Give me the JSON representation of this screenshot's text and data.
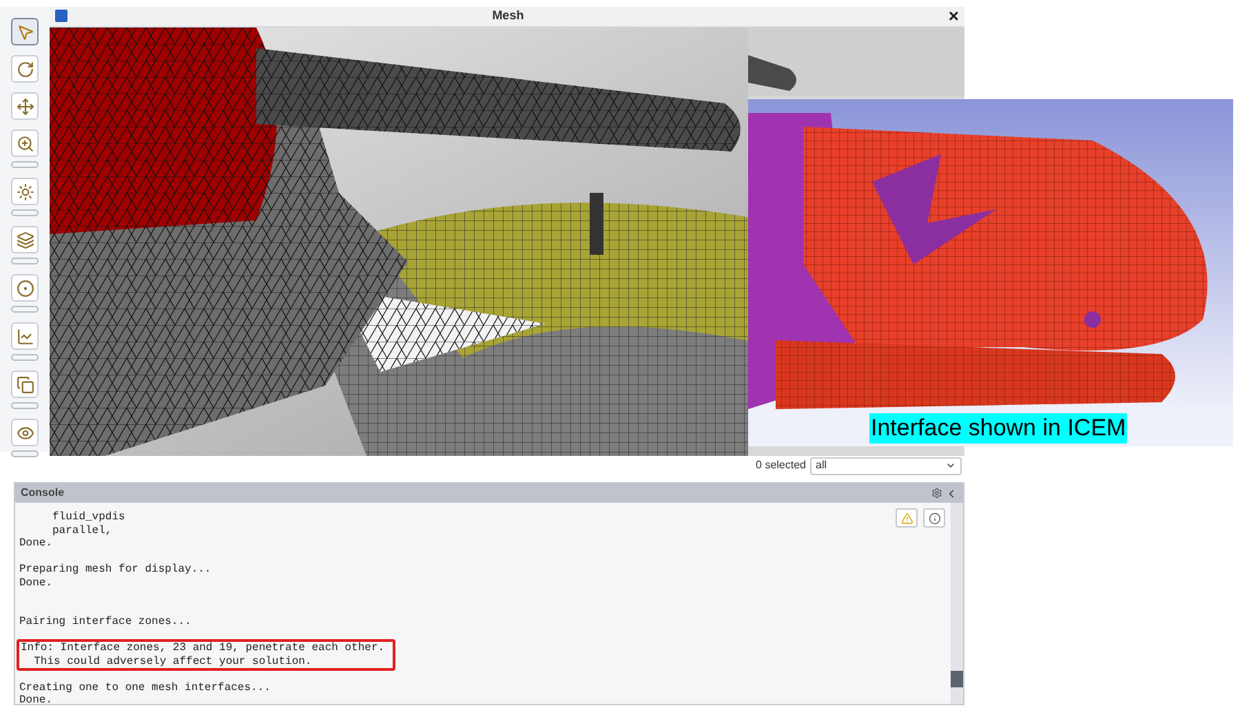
{
  "window": {
    "title": "Mesh",
    "close": "×"
  },
  "toolbar": [
    {
      "kind": "pointer",
      "selected": true
    },
    {
      "kind": "rotate",
      "selected": false
    },
    {
      "kind": "pan",
      "selected": false
    },
    {
      "kind": "zoom",
      "selected": false
    },
    {
      "kind": "lighting",
      "selected": false
    },
    {
      "kind": "layers",
      "selected": false
    },
    {
      "kind": "mesh",
      "selected": false
    },
    {
      "kind": "axes",
      "selected": false
    },
    {
      "kind": "copy",
      "selected": false
    },
    {
      "kind": "view",
      "selected": false
    }
  ],
  "inset": {
    "caption": "Interface shown in ICEM"
  },
  "selection": {
    "count": "0 selected",
    "filter": "all"
  },
  "console": {
    "title": "Console",
    "blocks": [
      {
        "boxed": false,
        "lines": [
          "     fluid_vpdis",
          "     parallel,",
          "Done."
        ]
      },
      {
        "boxed": false,
        "lines": [
          "Preparing mesh for display...",
          "Done."
        ]
      },
      {
        "boxed": false,
        "lines": [
          "Pairing interface zones..."
        ]
      },
      {
        "boxed": true,
        "lines": [
          "Info: Interface zones, 23 and 19, penetrate each other.",
          "  This could adversely affect your solution."
        ]
      },
      {
        "boxed": false,
        "lines": [
          "Creating one to one mesh interfaces...",
          "Done."
        ]
      }
    ]
  }
}
